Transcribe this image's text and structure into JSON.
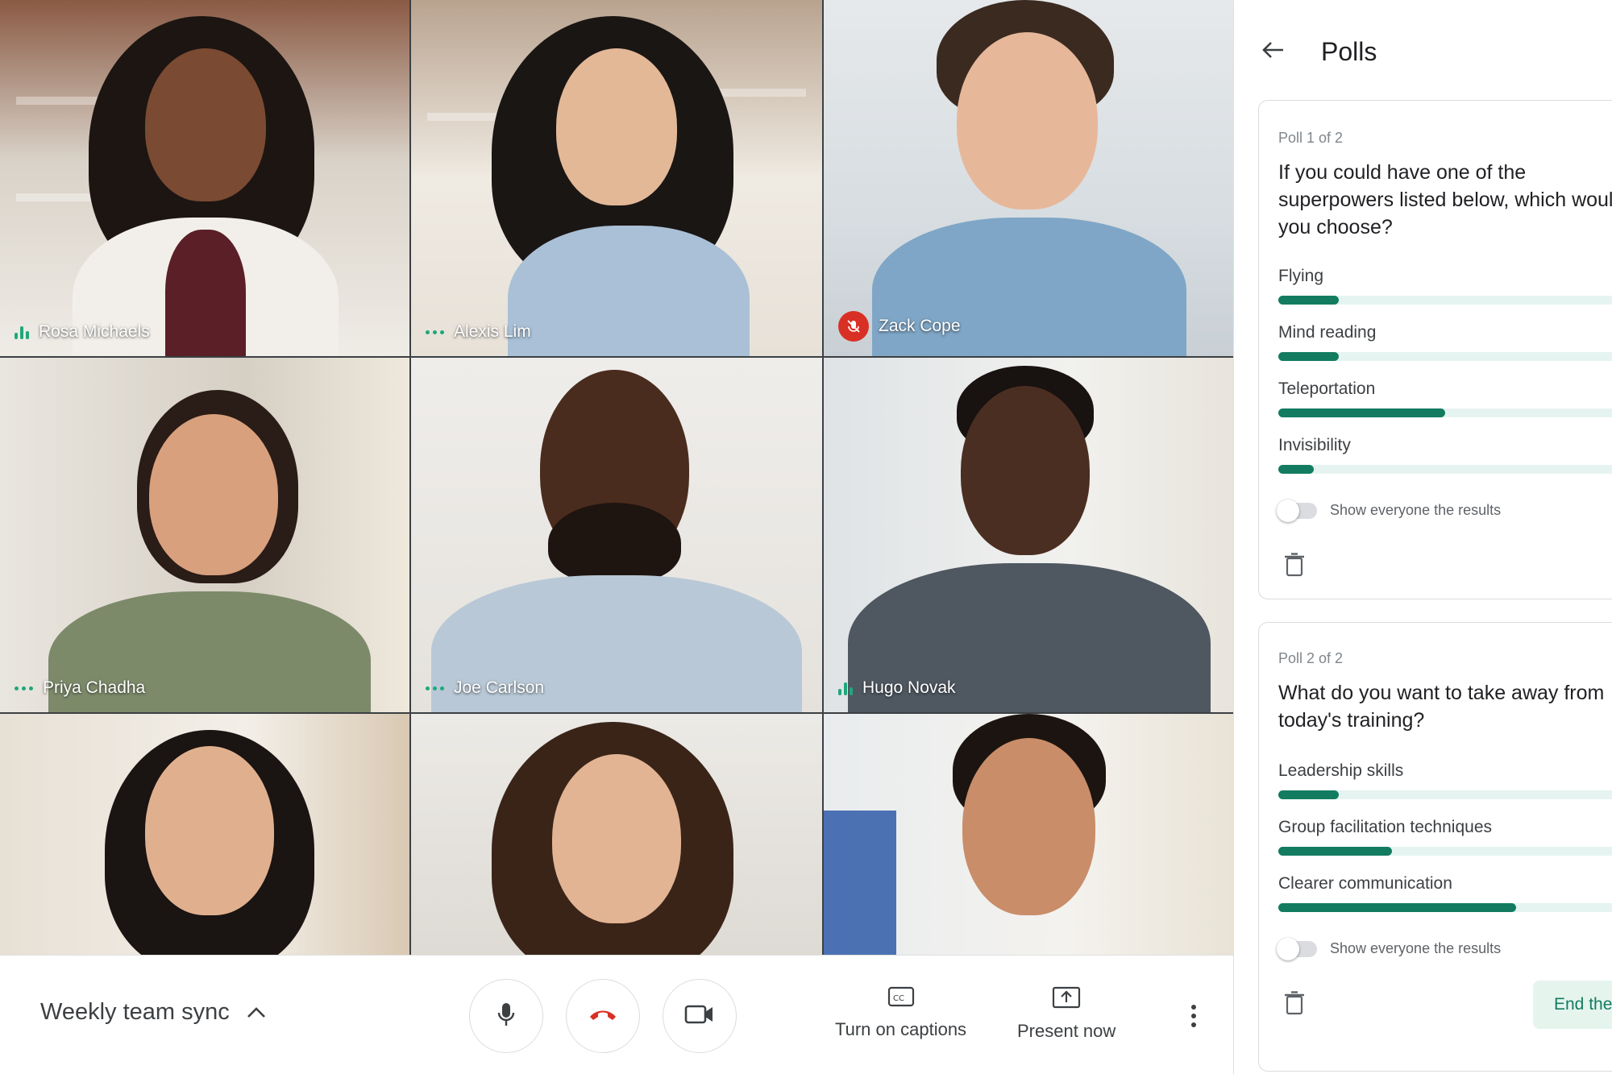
{
  "participants": [
    {
      "name": "Rosa Michaels",
      "status": "speaking"
    },
    {
      "name": "Alexis Lim",
      "status": "dots"
    },
    {
      "name": "Zack Cope",
      "status": "muted"
    },
    {
      "name": "Priya Chadha",
      "status": "dots"
    },
    {
      "name": "Joe Carlson",
      "status": "dots"
    },
    {
      "name": "Hugo Novak",
      "status": "speaking"
    }
  ],
  "bottom_bar": {
    "meeting_title": "Weekly team sync",
    "captions_label": "Turn on captions",
    "present_label": "Present now"
  },
  "panel": {
    "title": "Polls",
    "polls": [
      {
        "counter": "Poll 1 of 2",
        "question": "If you could have one of the superpowers listed below, which would you choose?",
        "options": [
          {
            "label": "Flying",
            "fraction": 0.17
          },
          {
            "label": "Mind reading",
            "fraction": 0.17
          },
          {
            "label": "Teleportation",
            "fraction": 0.47
          },
          {
            "label": "Invisibility",
            "fraction": 0.1
          }
        ],
        "toggle_label": "Show everyone the results"
      },
      {
        "counter": "Poll 2 of 2",
        "question": "What do you want to take away from today's training?",
        "options": [
          {
            "label": "Leadership skills",
            "fraction": 0.17
          },
          {
            "label": "Group facilitation techniques",
            "fraction": 0.32
          },
          {
            "label": "Clearer communication",
            "fraction": 0.67
          }
        ],
        "toggle_label": "Show everyone the results",
        "end_label": "End the poll"
      }
    ]
  },
  "colors": {
    "accent": "#137c60",
    "accent_light": "#e6f4f1",
    "hangup": "#d93025",
    "speaking": "#1ea87a"
  }
}
